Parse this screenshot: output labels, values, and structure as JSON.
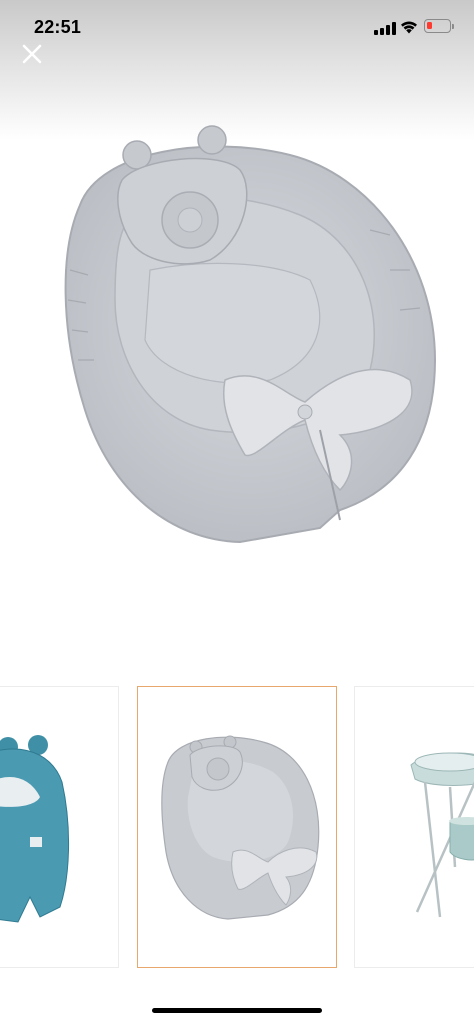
{
  "status_bar": {
    "time": "22:51",
    "icons": [
      "cellular-signal-icon",
      "wifi-icon",
      "battery-low-icon"
    ],
    "battery_color": "#ff3b30"
  },
  "toolbar": {
    "close_icon": "close-icon"
  },
  "gallery": {
    "selected_index": 1,
    "selected_border_color": "#e8a86d",
    "thumbnails": [
      {
        "subject": "teal-baby-swaddle-blanket"
      },
      {
        "subject": "grey-baby-nest-with-bow"
      },
      {
        "subject": "baby-bath-tub-on-stand"
      }
    ]
  }
}
